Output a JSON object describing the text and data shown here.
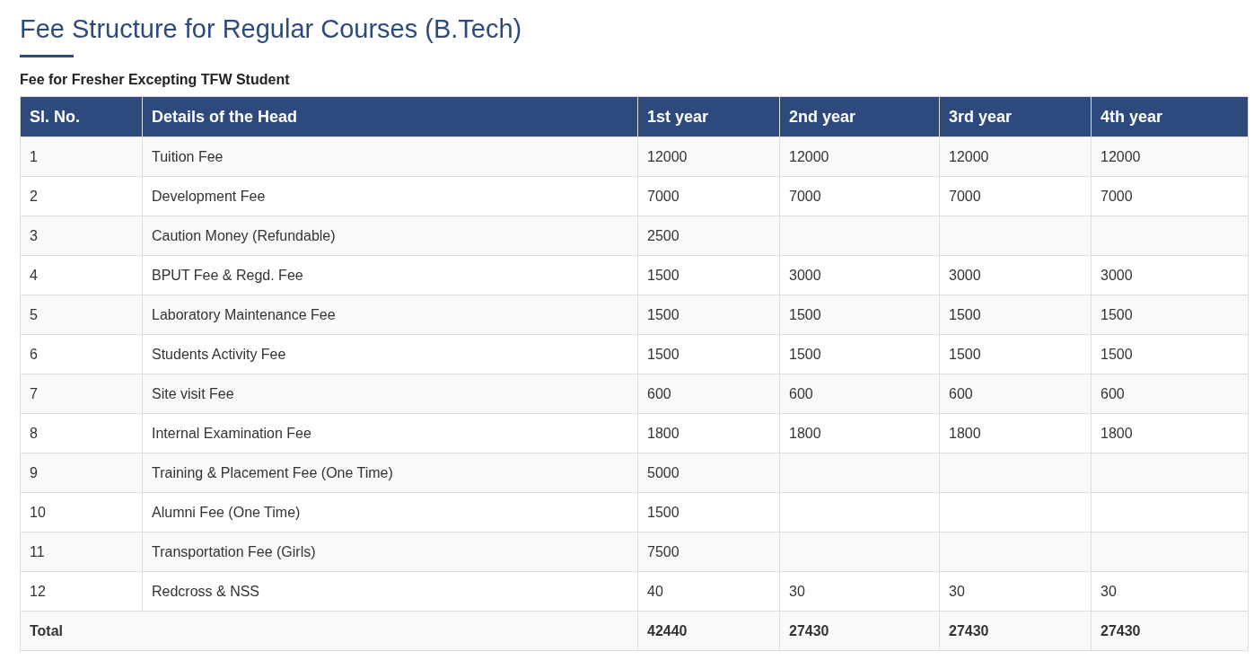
{
  "title": "Fee Structure for Regular Courses (B.Tech)",
  "subtitle": "Fee for Fresher Excepting TFW Student",
  "table": {
    "columns": [
      "Sl. No.",
      "Details of the Head",
      "1st year",
      "2nd year",
      "3rd year",
      "4th year"
    ],
    "rows": [
      [
        "1",
        "Tuition Fee",
        "12000",
        "12000",
        "12000",
        "12000"
      ],
      [
        "2",
        "Development Fee",
        "7000",
        "7000",
        "7000",
        "7000"
      ],
      [
        "3",
        "Caution Money (Refundable)",
        "2500",
        "",
        "",
        ""
      ],
      [
        "4",
        "BPUT Fee & Regd. Fee",
        "1500",
        "3000",
        "3000",
        "3000"
      ],
      [
        "5",
        "Laboratory Maintenance Fee",
        "1500",
        "1500",
        "1500",
        "1500"
      ],
      [
        "6",
        "Students Activity Fee",
        "1500",
        "1500",
        "1500",
        "1500"
      ],
      [
        "7",
        "Site visit Fee",
        "600",
        "600",
        "600",
        "600"
      ],
      [
        "8",
        "Internal Examination Fee",
        "1800",
        "1800",
        "1800",
        "1800"
      ],
      [
        "9",
        "Training & Placement Fee (One Time)",
        "5000",
        "",
        "",
        ""
      ],
      [
        "10",
        "Alumni Fee (One Time)",
        "1500",
        "",
        "",
        ""
      ],
      [
        "11",
        "Transportation Fee (Girls)",
        "7500",
        "",
        "",
        ""
      ],
      [
        "12",
        "Redcross & NSS",
        "40",
        "30",
        "30",
        "30"
      ]
    ],
    "total": {
      "label": "Total",
      "values": [
        "42440",
        "27430",
        "27430",
        "27430"
      ]
    }
  }
}
